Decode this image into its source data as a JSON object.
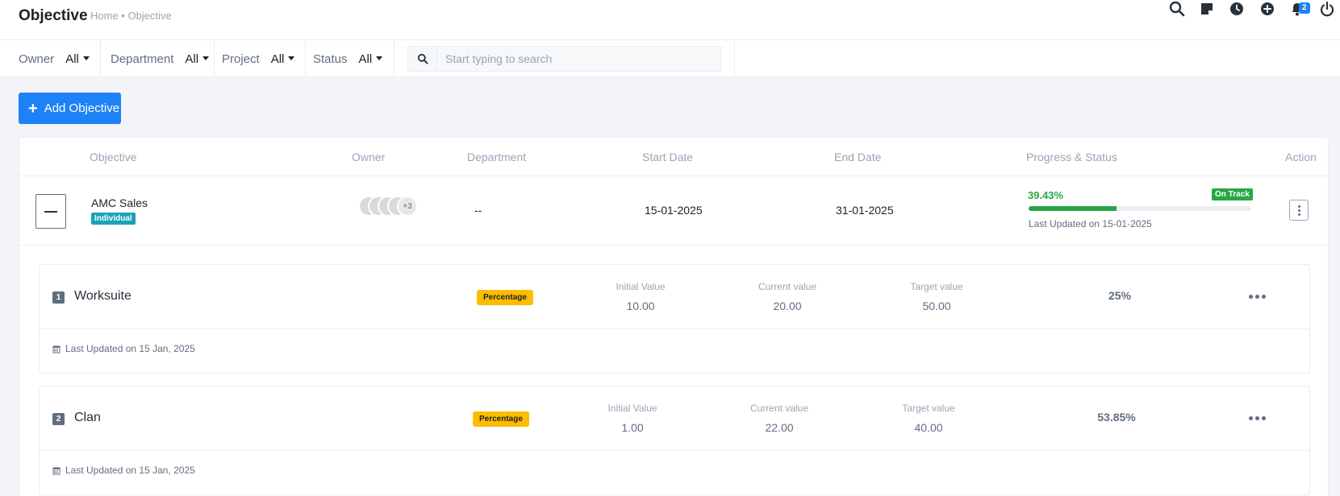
{
  "header": {
    "title": "Objective",
    "breadcrumb": "Home • Objective",
    "notification_count": "2",
    "icons": [
      "search-icon",
      "sticky-note-icon",
      "clock-icon",
      "plus-circle-icon",
      "bell-icon",
      "power-icon"
    ]
  },
  "filters": {
    "owner": {
      "label": "Owner",
      "value": "All"
    },
    "department": {
      "label": "Department",
      "value": "All"
    },
    "project": {
      "label": "Project",
      "value": "All"
    },
    "status": {
      "label": "Status",
      "value": "All"
    },
    "search_placeholder": "Start typing to search"
  },
  "add_button": "Add Objective",
  "table": {
    "headers": {
      "objective": "Objective",
      "owner": "Owner",
      "department": "Department",
      "start_date": "Start Date",
      "end_date": "End Date",
      "progress": "Progress & Status",
      "action": "Action"
    },
    "row": {
      "name": "AMC Sales",
      "type_badge": "Individual",
      "owner_more": "+3",
      "department": "--",
      "start_date": "15-01-2025",
      "end_date": "31-01-2025",
      "progress_text": "39.43%",
      "progress_value": 39.43,
      "status": "On Track",
      "last_updated": "Last Updated on 15-01-2025"
    }
  },
  "key_results": [
    {
      "number": "1",
      "name": "Worksuite",
      "type": "Percentage",
      "initial_label": "Initial Value",
      "initial": "10.00",
      "current_label": "Current value",
      "current": "20.00",
      "target_label": "Target value",
      "target": "50.00",
      "percent": "25%",
      "last_updated": "Last Updated on 15 Jan, 2025"
    },
    {
      "number": "2",
      "name": "Clan",
      "type": "Percentage",
      "initial_label": "Initial Value",
      "initial": "1.00",
      "current_label": "Current value",
      "current": "22.00",
      "target_label": "Target value",
      "target": "40.00",
      "percent": "53.85%",
      "last_updated": "Last Updated on 15 Jan, 2025"
    }
  ],
  "colors": {
    "primary": "#1d82f5",
    "success": "#28a745",
    "warning": "#fcbd01",
    "info": "#17a2b8"
  }
}
